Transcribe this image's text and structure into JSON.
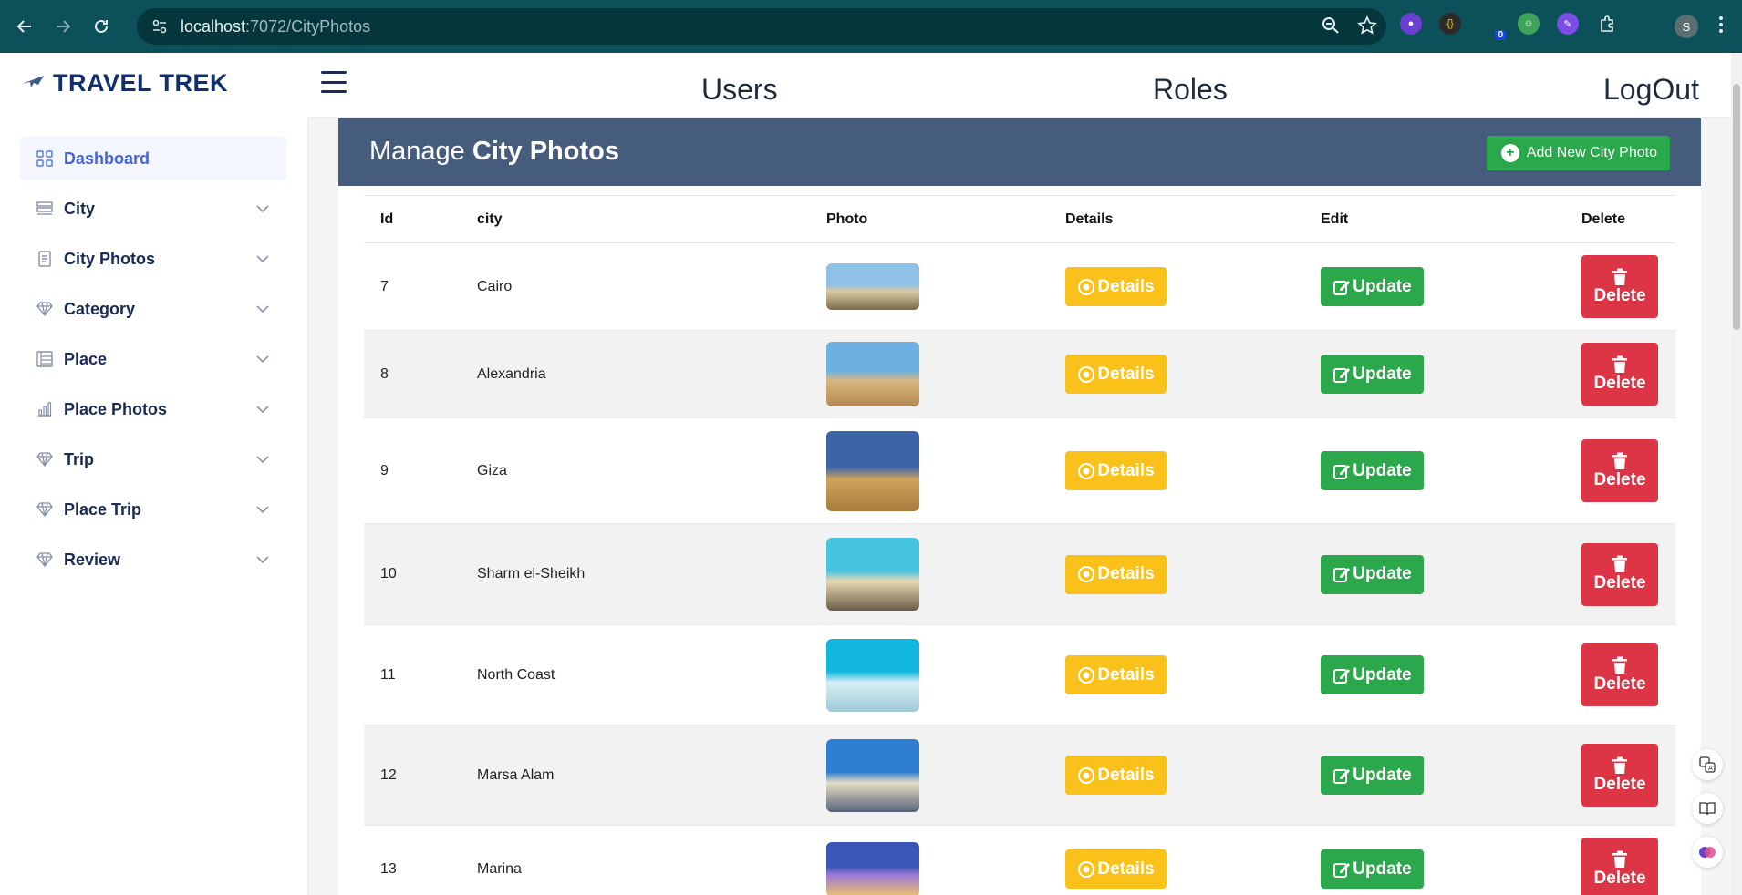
{
  "browser": {
    "url_host": "localhost",
    "url_rest": ":7072/CityPhotos",
    "profile_initial": "S",
    "extension_badge": "0"
  },
  "header": {
    "brand": "TRAVEL TREK",
    "links": [
      "Users",
      "Roles",
      "LogOut"
    ]
  },
  "sidebar": {
    "items": [
      {
        "label": "Dashboard",
        "icon": "grid-icon",
        "active": true
      },
      {
        "label": "City",
        "icon": "layers-icon"
      },
      {
        "label": "City Photos",
        "icon": "document-icon"
      },
      {
        "label": "Category",
        "icon": "diamond-icon"
      },
      {
        "label": "Place",
        "icon": "list-icon"
      },
      {
        "label": "Place Photos",
        "icon": "bar-chart-icon"
      },
      {
        "label": "Trip",
        "icon": "diamond-icon"
      },
      {
        "label": "Place Trip",
        "icon": "diamond-icon"
      },
      {
        "label": "Review",
        "icon": "diamond-icon"
      }
    ]
  },
  "panel": {
    "title_prefix": "Manage",
    "title_bold": "City Photos",
    "add_button": "Add New City Photo"
  },
  "table": {
    "headers": [
      "Id",
      "city",
      "Photo",
      "Details",
      "Edit",
      "Delete"
    ],
    "details_label": "Details",
    "update_label": "Update",
    "delete_label": "Delete",
    "rows": [
      {
        "id": "7",
        "city": "Cairo",
        "photo": "cairo-tower-photo"
      },
      {
        "id": "8",
        "city": "Alexandria",
        "photo": "citadel-photo"
      },
      {
        "id": "9",
        "city": "Giza",
        "photo": "pyramids-photo"
      },
      {
        "id": "10",
        "city": "Sharm el-Sheikh",
        "photo": "beach-umbrellas-photo"
      },
      {
        "id": "11",
        "city": "North Coast",
        "photo": "turquoise-coast-photo"
      },
      {
        "id": "12",
        "city": "Marsa Alam",
        "photo": "pier-beach-photo"
      },
      {
        "id": "13",
        "city": "Marina",
        "photo": "marina-city-photo"
      }
    ]
  }
}
